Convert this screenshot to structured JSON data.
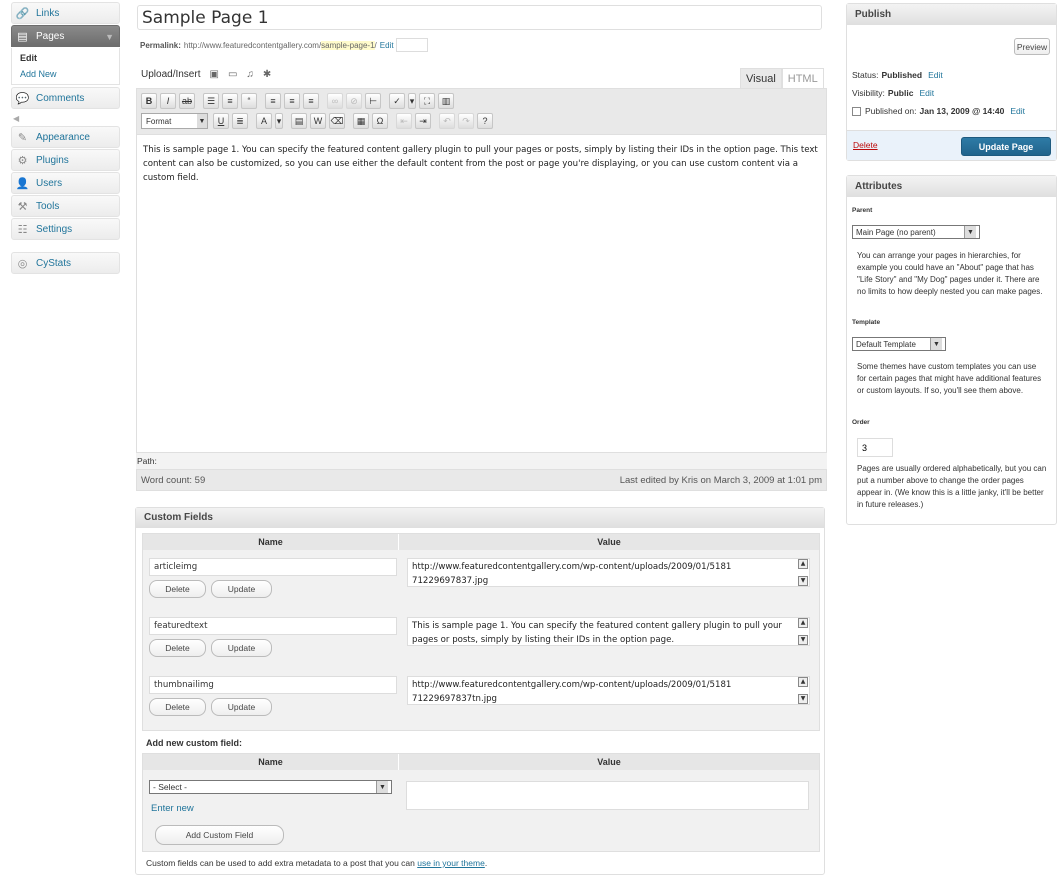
{
  "sidebar": {
    "items": [
      {
        "label": "Links",
        "icon": "links-icon",
        "glyph": "🔗"
      },
      {
        "label": "Pages",
        "icon": "pages-icon",
        "glyph": "▤"
      },
      {
        "label": "Comments",
        "icon": "comments-icon",
        "glyph": "💬"
      },
      {
        "label": "Appearance",
        "icon": "appearance-icon",
        "glyph": "✎"
      },
      {
        "label": "Plugins",
        "icon": "plugins-icon",
        "glyph": "⚙"
      },
      {
        "label": "Users",
        "icon": "users-icon",
        "glyph": "👤"
      },
      {
        "label": "Tools",
        "icon": "tools-icon",
        "glyph": "⚒"
      },
      {
        "label": "Settings",
        "icon": "settings-icon",
        "glyph": "☷"
      },
      {
        "label": "CyStats",
        "icon": "cystats-icon",
        "glyph": "◎"
      }
    ],
    "pages_submenu": {
      "edit": "Edit",
      "add_new": "Add New"
    }
  },
  "editor": {
    "title": "Sample Page 1",
    "permalink_label": "Permalink:",
    "permalink_base": "http://www.featuredcontentgallery.com/",
    "permalink_slug": "sample-page-1",
    "permalink_tail": "/",
    "permalink_edit": "Edit",
    "upload_insert": "Upload/Insert",
    "tab_visual": "Visual",
    "tab_html": "HTML",
    "format_select": "Format",
    "content": "This is sample page 1. You can specify the featured content gallery plugin to pull your pages or posts, simply by listing their IDs in the option page. This text content can also be customized, so you can use either the default content from the post or page you're displaying, or you can use custom content via a custom field.",
    "path_label": "Path:",
    "word_count": "Word count: 59",
    "last_edited": "Last edited by Kris on March 3, 2009 at 1:01 pm"
  },
  "custom_fields": {
    "title": "Custom Fields",
    "col_name": "Name",
    "col_value": "Value",
    "delete_label": "Delete",
    "update_label": "Update",
    "rows": [
      {
        "name": "articleimg",
        "value": "http://www.featuredcontentgallery.com/wp-content/uploads/2009/01/5181 71229697837.jpg"
      },
      {
        "name": "featuredtext",
        "value": "This is sample page 1. You can specify the featured content gallery plugin to pull your pages or posts, simply by listing their IDs in the option page."
      },
      {
        "name": "thumbnailimg",
        "value": "http://www.featuredcontentgallery.com/wp-content/uploads/2009/01/5181 71229697837tn.jpg"
      }
    ],
    "add_new_label": "Add new custom field:",
    "select_placeholder": "- Select -",
    "enter_new": "Enter new",
    "add_button": "Add Custom Field",
    "note_text": "Custom fields can be used to add extra metadata to a post that you can ",
    "note_link": "use in your theme",
    "note_end": "."
  },
  "publish": {
    "title": "Publish",
    "preview": "Preview",
    "status_label": "Status:",
    "status_value": "Published",
    "visibility_label": "Visibility:",
    "visibility_value": "Public",
    "published_label": "Published on:",
    "published_value": "Jan 13, 2009 @ 14:40",
    "edit": "Edit",
    "delete": "Delete",
    "update": "Update Page"
  },
  "attributes": {
    "title": "Attributes",
    "parent_label": "Parent",
    "parent_value": "Main Page (no parent)",
    "parent_help": "You can arrange your pages in hierarchies, for example you could have an \"About\" page that has \"Life Story\" and \"My Dog\" pages under it. There are no limits to how deeply nested you can make pages.",
    "template_label": "Template",
    "template_value": "Default Template",
    "template_help": "Some themes have custom templates you can use for certain pages that might have additional features or custom layouts. If so, you'll see them above.",
    "order_label": "Order",
    "order_value": "3",
    "order_help": "Pages are usually ordered alphabetically, but you can put a number above to change the order pages appear in. (We know this is a little janky, it'll be better in future releases.)"
  }
}
